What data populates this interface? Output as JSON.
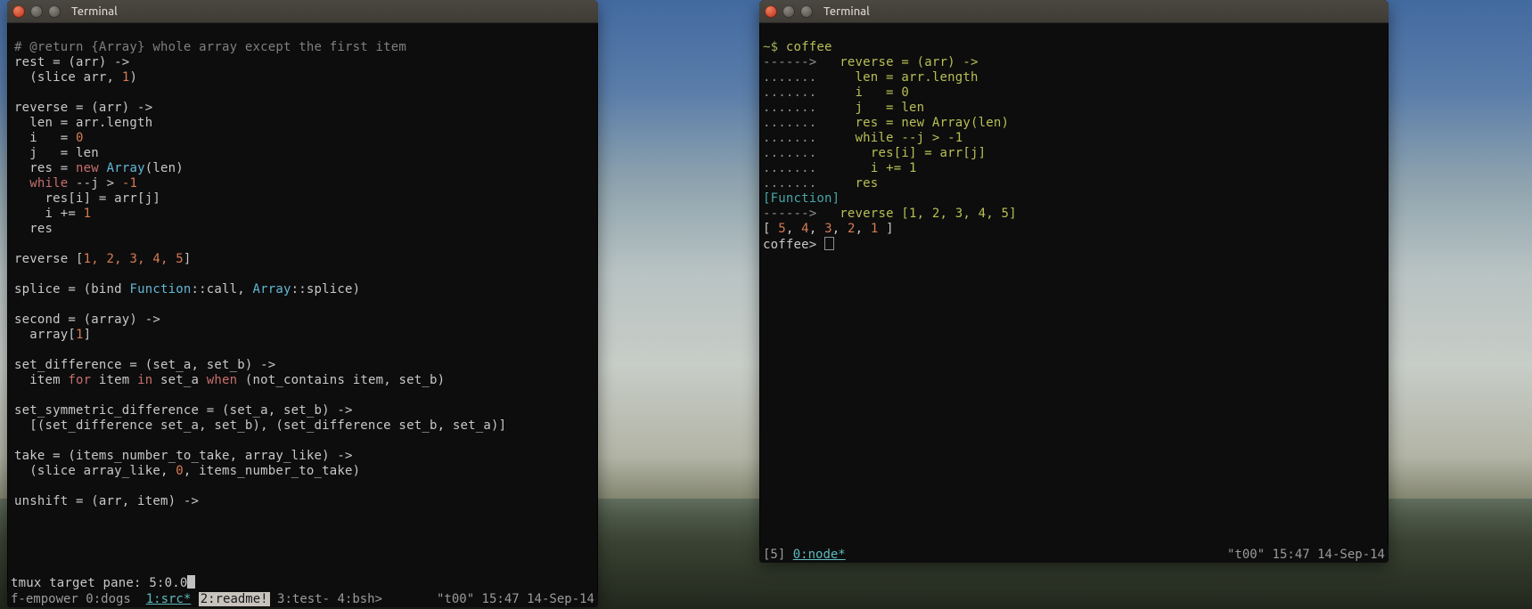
{
  "left_window": {
    "title": "Terminal",
    "tmux_line": "tmux target pane: 5:0.0",
    "status": {
      "left": "f-empower 0:dogs",
      "w1": "1:src*",
      "w2": "2:readme!",
      "rest": "3:test- 4:bsh>",
      "right": "\"t00\" 15:47 14-Sep-14"
    },
    "code": {
      "l00": "# @return {Array} whole array except the first item",
      "l01a": "rest = (arr) ->",
      "l02a": "  (slice arr, ",
      "l02n": "1",
      "l02b": ")",
      "l03": "",
      "l04": "reverse = (arr) ->",
      "l05": "  len = arr.length",
      "l06a": "  i   = ",
      "l06n": "0",
      "l07": "  j   = len",
      "l08a": "  res = ",
      "l08k": "new",
      "l08b": " ",
      "l08t": "Array",
      "l08c": "(len)",
      "l09a": "  ",
      "l09k": "while",
      "l09b": " --j > ",
      "l09n": "-1",
      "l10": "    res[i] = arr[j]",
      "l11a": "    i += ",
      "l11n": "1",
      "l12": "  res",
      "l13": "",
      "l14a": "reverse [",
      "l14n": "1, 2, 3, 4, 5",
      "l14b": "]",
      "l15": "",
      "l16a": "splice = (bind ",
      "l16t1": "Function",
      "l16b": "::call, ",
      "l16t2": "Array",
      "l16c": "::splice)",
      "l17": "",
      "l18": "second = (array) ->",
      "l19a": "  array[",
      "l19n": "1",
      "l19b": "]",
      "l20": "",
      "l21": "set_difference = (set_a, set_b) ->",
      "l22a": "  item ",
      "l22k1": "for",
      "l22b": " item ",
      "l22k2": "in",
      "l22c": " set_a ",
      "l22k3": "when",
      "l22d": " (not_contains item, set_b)",
      "l23": "",
      "l24": "set_symmetric_difference = (set_a, set_b) ->",
      "l25": "  [(set_difference set_a, set_b), (set_difference set_b, set_a)]",
      "l26": "",
      "l27": "take = (items_number_to_take, array_like) ->",
      "l28a": "  (slice array_like, ",
      "l28n": "0",
      "l28b": ", items_number_to_take)",
      "l29": "",
      "l30": "unshift = (arr, item) ->"
    }
  },
  "right_window": {
    "title": "Terminal",
    "status": {
      "left": "[5]",
      "win": "0:node*",
      "right": "\"t00\" 15:47 14-Sep-14"
    },
    "repl": {
      "r00a": "~$ ",
      "r00b": "coffee",
      "r01a": "------>   ",
      "r01b": "reverse = (arr) ->",
      "r02a": ".......     ",
      "r02b": "len = arr.length",
      "r03a": ".......     ",
      "r03b": "i   = 0",
      "r04a": ".......     ",
      "r04b": "j   = len",
      "r05a": ".......     ",
      "r05b": "res = new Array(len)",
      "r06a": ".......     ",
      "r06b": "while --j > -1",
      "r07a": ".......       ",
      "r07b": "res[i] = arr[j]",
      "r08a": ".......       ",
      "r08b": "i += 1",
      "r09a": ".......     ",
      "r09b": "res",
      "r10": "[Function]",
      "r11a": "------>   ",
      "r11b": "reverse [1, 2, 3, 4, 5]",
      "r12a": "[ ",
      "r12b": "5",
      "r12c": ", ",
      "r12d": "4",
      "r12e": ", ",
      "r12f": "3",
      "r12g": ", ",
      "r12h": "2",
      "r12i": ", ",
      "r12j": "1",
      "r12k": " ]",
      "r13": "coffee> "
    }
  }
}
